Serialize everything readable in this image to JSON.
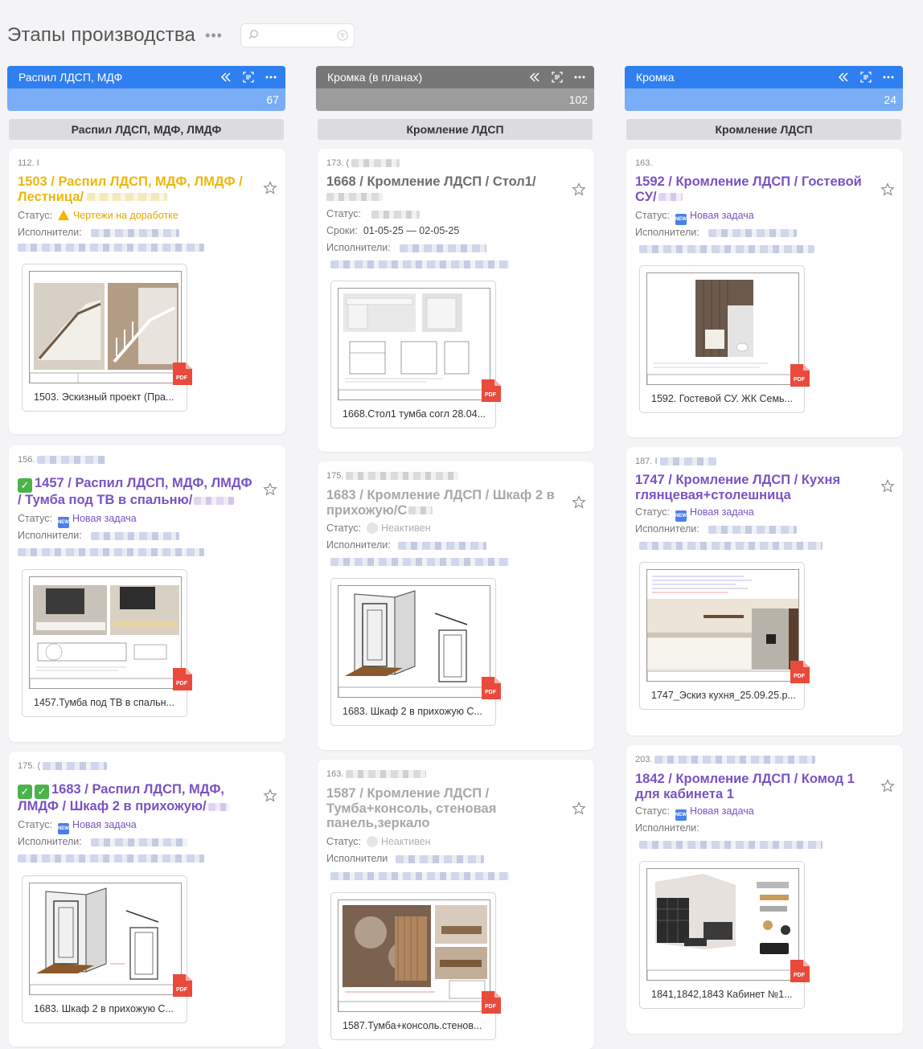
{
  "page": {
    "title": "Этапы производства",
    "more": "•••",
    "search": {
      "value": "",
      "placeholder": ""
    }
  },
  "icons": {
    "collapse": "double-chevron-left-icon",
    "scan": "scan-icon",
    "more": "more-horizontal-icon",
    "star": "star-icon",
    "search": "search-icon",
    "filter": "filter-icon",
    "pdf": "pdf-icon"
  },
  "labels": {
    "status": "Статус:",
    "assignees": "Исполнители:",
    "assignees_short": "Исполнители",
    "dates": "Сроки:",
    "pdf": "PDF"
  },
  "colors": {
    "accent_blue": "#2f7ff0",
    "column_gray": "#777777",
    "title_purple": "#7a52c3",
    "title_yellow": "#ecb70d",
    "check_green": "#4cb34a"
  },
  "columns": [
    {
      "name": "Распил ЛДСП, МДФ",
      "count": "67",
      "stage": "Распил ЛДСП, МДФ, ЛМДФ",
      "cards": [
        {
          "id": "112. I",
          "checks": 0,
          "title": "1503 / Распил ЛДСП, МДФ, ЛМДФ / Лестница/",
          "status": "Чертежи на доработке",
          "status_type": "warning",
          "dates": "",
          "attachment": "1503. Эскизный проект (Пра..."
        },
        {
          "id": "156.",
          "checks": 1,
          "title": "1457 / Распил ЛДСП, МДФ, ЛМДФ / Тумба под ТВ в спальню/",
          "status": "Новая задача",
          "status_type": "new",
          "dates": "",
          "attachment": "1457.Тумба под ТВ в спальн..."
        },
        {
          "id": "175. (",
          "checks": 2,
          "title": "1683 / Распил ЛДСП, МДФ, ЛМДФ / Шкаф 2 в прихожую/",
          "status": "Новая задача",
          "status_type": "new",
          "dates": "",
          "attachment": "1683. Шкаф 2 в прихожую С..."
        }
      ]
    },
    {
      "name": "Кромка (в планах)",
      "count": "102",
      "stage": "Кромление ЛДСП",
      "cards": [
        {
          "id": "173. (",
          "checks": 0,
          "title": "1668 / Кромление ЛДСП / Стол1/",
          "status": "",
          "status_type": "blank",
          "dates": "01-05-25 — 02-05-25",
          "attachment": "1668.Стол1 тумба согл 28.04..."
        },
        {
          "id": "175.",
          "checks": 0,
          "title": "1683 / Кромление ЛДСП / Шкаф 2 в прихожую/С",
          "status": "Неактивен",
          "status_type": "inactive",
          "dates": "",
          "attachment": "1683. Шкаф 2 в прихожую С..."
        },
        {
          "id": "163.",
          "checks": 0,
          "title": "1587 / Кромление ЛДСП / Тумба+консоль, стеновая панель,зеркало",
          "status": "Неактивен",
          "status_type": "inactive",
          "dates": "",
          "attachment": "1587.Тумба+консоль.стенов..."
        }
      ]
    },
    {
      "name": "Кромка",
      "count": "24",
      "stage": "Кромление ЛДСП",
      "cards": [
        {
          "id": "163.",
          "checks": 0,
          "title": "1592 / Кромление ЛДСП / Гостевой СУ/",
          "status": "Новая задача",
          "status_type": "new",
          "dates": "",
          "attachment": "1592. Гостевой СУ. ЖК Семь..."
        },
        {
          "id": "187. I",
          "checks": 0,
          "title": "1747 / Кромление ЛДСП / Кухня глянцевая+столешница",
          "status": "Новая задача",
          "status_type": "new",
          "dates": "",
          "attachment": "1747_Эскиз кухня_25.09.25.p..."
        },
        {
          "id": "203.",
          "checks": 0,
          "title": "1842 / Кромление ЛДСП / Комод 1 для кабинета 1",
          "status": "Новая задача",
          "status_type": "new",
          "dates": "",
          "attachment": "1841,1842,1843 Кабинет №1..."
        }
      ]
    }
  ]
}
